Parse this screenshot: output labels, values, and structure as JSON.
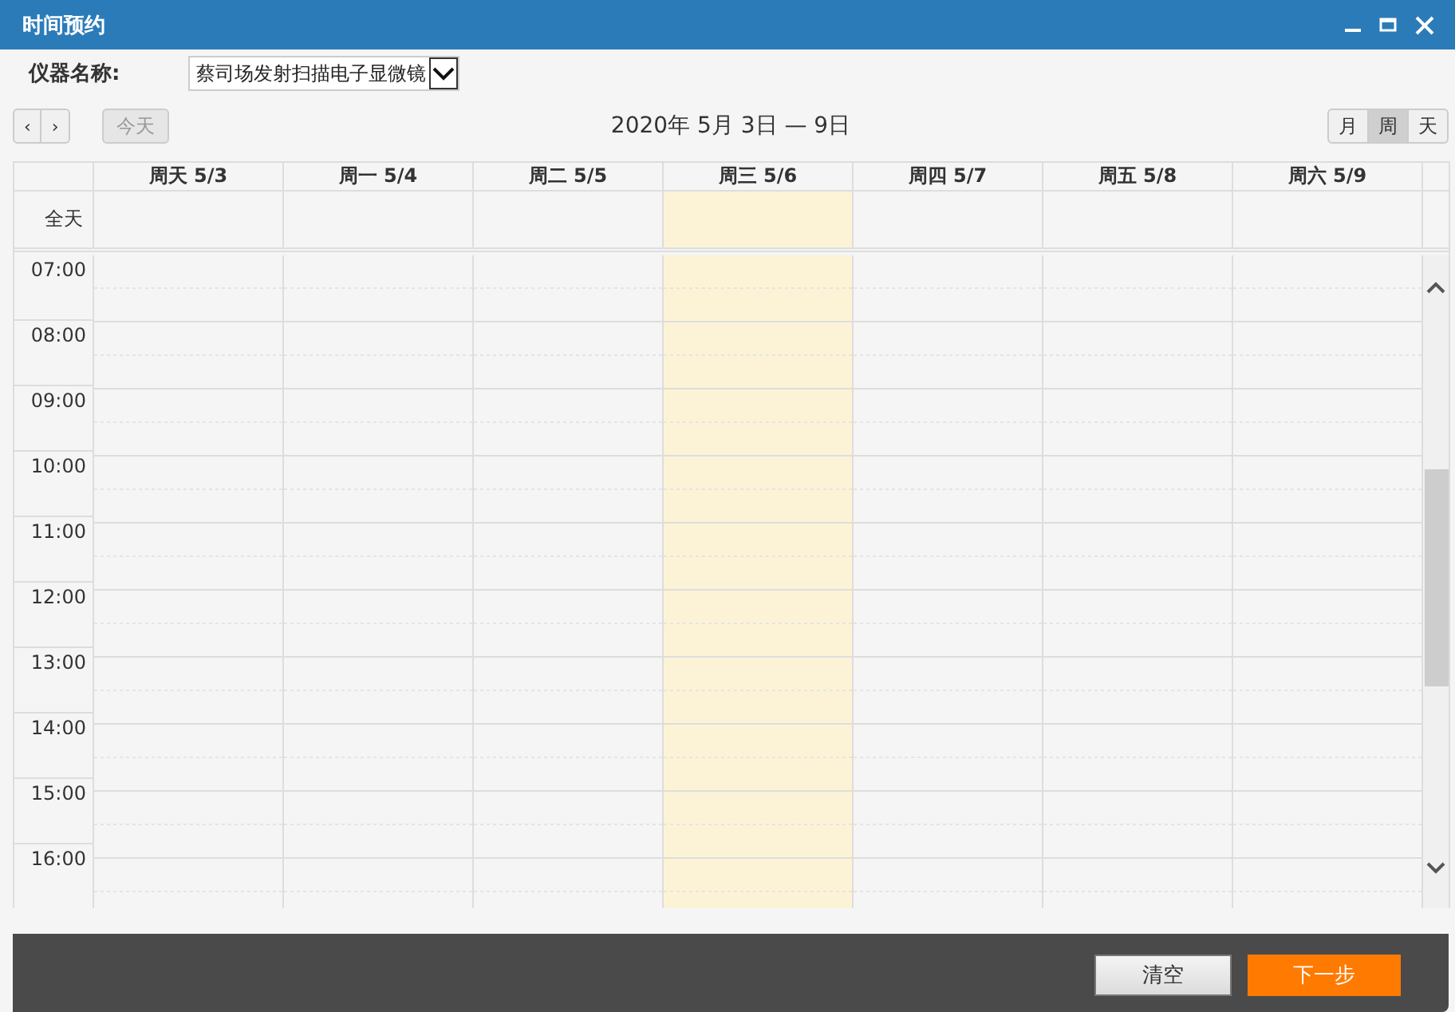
{
  "window": {
    "title": "时间预约"
  },
  "instrument": {
    "label": "仪器名称:",
    "value": "蔡司场发射扫描电子显微镜"
  },
  "toolbar": {
    "prev": "‹",
    "next": "›",
    "today": {
      "label": "今天",
      "disabled": true
    },
    "range": "2020年 5月 3日 — 9日",
    "views": [
      {
        "label": "月",
        "selected": false
      },
      {
        "label": "周",
        "selected": true
      },
      {
        "label": "天",
        "selected": false
      }
    ]
  },
  "calendar": {
    "all_day_label": "全天",
    "days": [
      {
        "label": "周天 5/3",
        "today": false
      },
      {
        "label": "周一 5/4",
        "today": false
      },
      {
        "label": "周二 5/5",
        "today": false
      },
      {
        "label": "周三 5/6",
        "today": true
      },
      {
        "label": "周四 5/7",
        "today": false
      },
      {
        "label": "周五 5/8",
        "today": false
      },
      {
        "label": "周六 5/9",
        "today": false
      }
    ],
    "hours": [
      "07:00",
      "08:00",
      "09:00",
      "10:00",
      "11:00",
      "12:00",
      "13:00",
      "14:00",
      "15:00",
      "16:00"
    ]
  },
  "footer": {
    "buttons": [
      {
        "label": "清空",
        "kind": "secondary"
      },
      {
        "label": "下一步",
        "kind": "primary"
      }
    ]
  }
}
